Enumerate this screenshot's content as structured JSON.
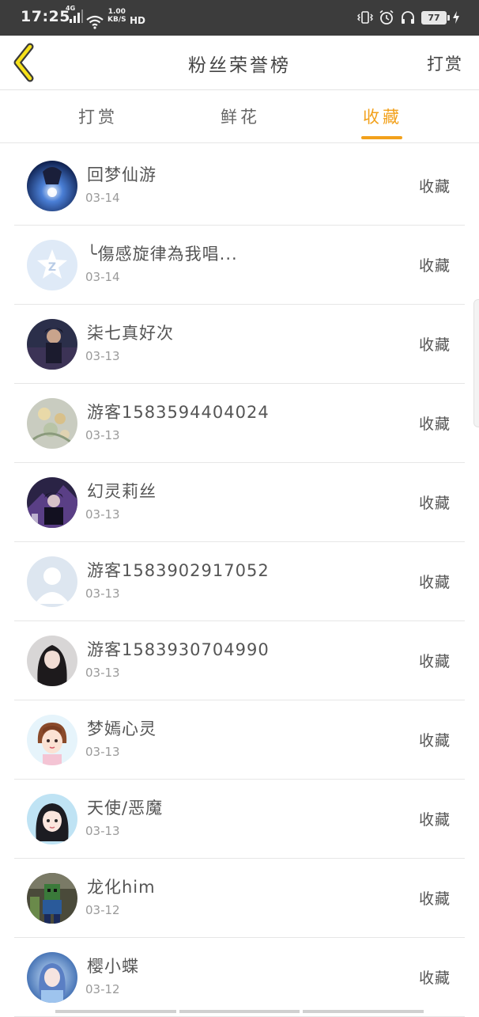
{
  "status_bar": {
    "time": "17:25",
    "network": "4G",
    "speed_value": "1.00",
    "speed_unit": "KB/S",
    "hd": "HD",
    "battery": "77"
  },
  "header": {
    "title": "粉丝荣誉榜",
    "right_link": "打赏",
    "back_icon": "chevron-left-icon",
    "accent_color": "#f2a11c"
  },
  "tabs": [
    {
      "label": "打赏",
      "active": false
    },
    {
      "label": "鲜花",
      "active": false
    },
    {
      "label": "收藏",
      "active": true
    }
  ],
  "fans": [
    {
      "name": "回梦仙游",
      "date": "03-14",
      "action": "收藏"
    },
    {
      "name": "╰傷感旋律為我唱...",
      "date": "03-14",
      "action": "收藏"
    },
    {
      "name": "柒七真好次",
      "date": "03-13",
      "action": "收藏"
    },
    {
      "name": "游客1583594404024",
      "date": "03-13",
      "action": "收藏"
    },
    {
      "name": "幻灵莉丝",
      "date": "03-13",
      "action": "收藏"
    },
    {
      "name": "游客1583902917052",
      "date": "03-13",
      "action": "收藏"
    },
    {
      "name": "游客1583930704990",
      "date": "03-13",
      "action": "收藏"
    },
    {
      "name": "梦嫣心灵",
      "date": "03-13",
      "action": "收藏"
    },
    {
      "name": "天使/恶魔",
      "date": "03-13",
      "action": "收藏"
    },
    {
      "name": "龙化him",
      "date": "03-12",
      "action": "收藏"
    },
    {
      "name": "樱小蝶",
      "date": "03-12",
      "action": "收藏"
    }
  ]
}
